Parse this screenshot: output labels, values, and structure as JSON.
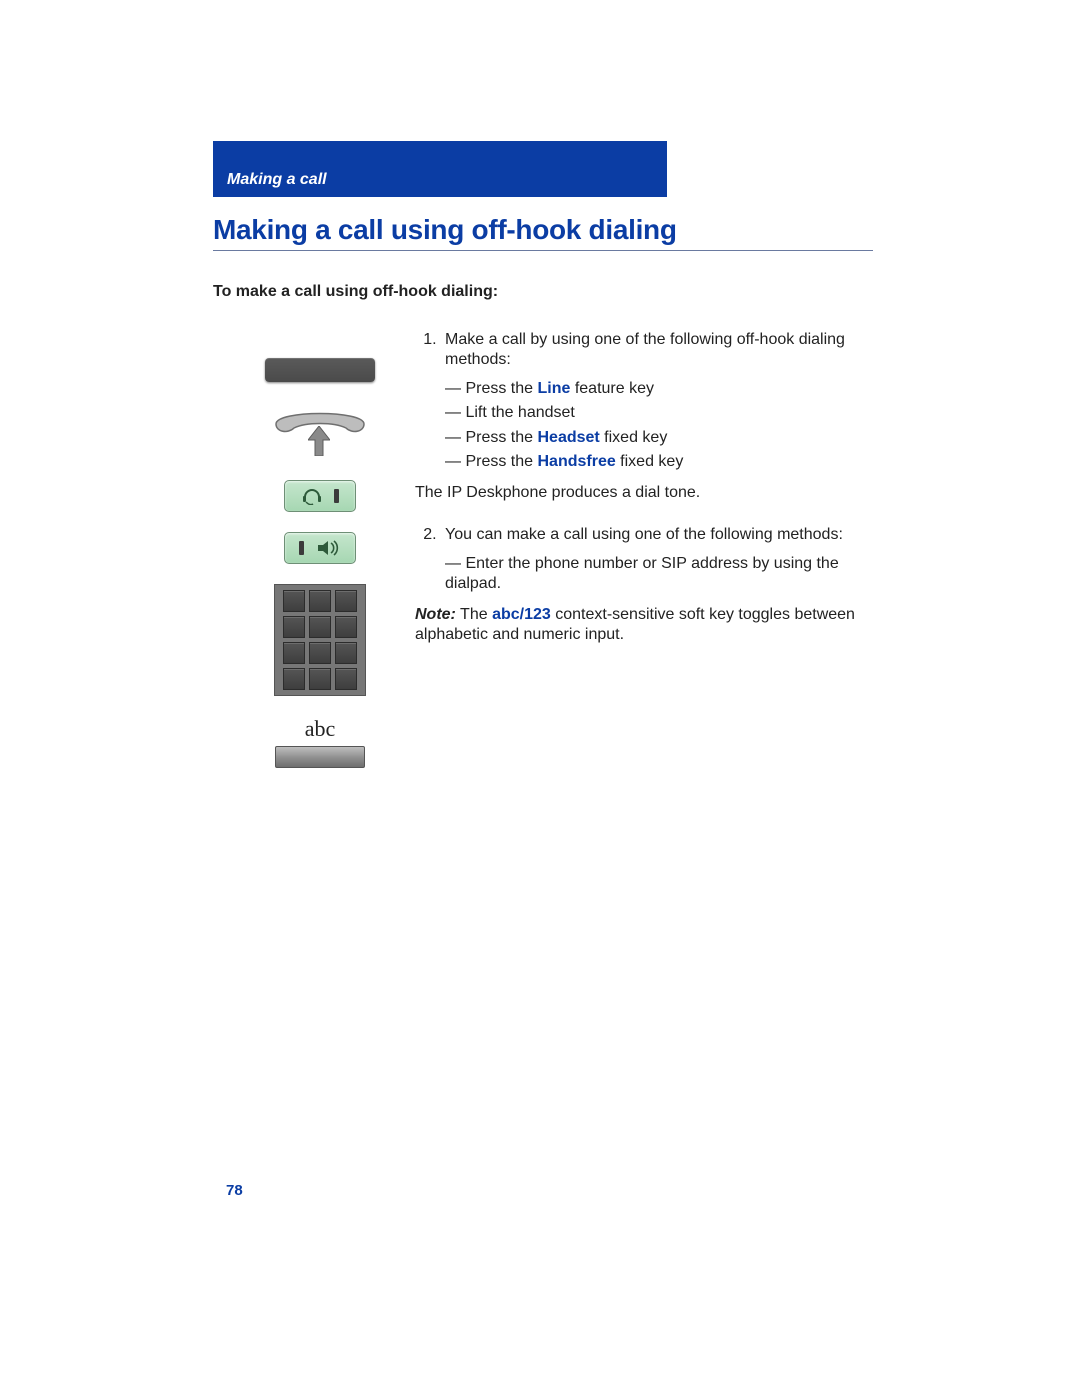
{
  "header": {
    "section": "Making a call"
  },
  "heading": "Making a call using off-hook dialing",
  "subheading": "To make a call using off-hook dialing:",
  "icons": {
    "feature_key": "line-feature-key",
    "handset": "handset",
    "headset_key": "headset-key",
    "handsfree_key": "handsfree-key",
    "dialpad": "dialpad",
    "abc_label": "abc",
    "abc_softkey": "abc-softkey"
  },
  "steps": [
    {
      "num": "1.",
      "lead": "Make a call by using one of the following off-hook dialing methods:",
      "bullets": [
        {
          "pre": "Press the ",
          "emph": "Line",
          "post": " feature key"
        },
        {
          "pre": "Lift the handset",
          "emph": "",
          "post": ""
        },
        {
          "pre": "Press the ",
          "emph": "Headset",
          "post": " fixed key"
        },
        {
          "pre": "Press the ",
          "emph": "Handsfree",
          "post": " fixed key"
        }
      ],
      "after": "The IP Deskphone produces a dial tone."
    },
    {
      "num": "2.",
      "lead": "You can make a call using one of the following methods:",
      "bullets": [
        {
          "pre": "Enter the phone number or SIP address by using the dialpad.",
          "emph": "",
          "post": ""
        }
      ],
      "note": {
        "label": "Note:",
        "pre": "  The ",
        "emph": "abc/123",
        "post": " context-sensitive soft key toggles between alphabetic and numeric input."
      }
    }
  ],
  "page_number": "78"
}
